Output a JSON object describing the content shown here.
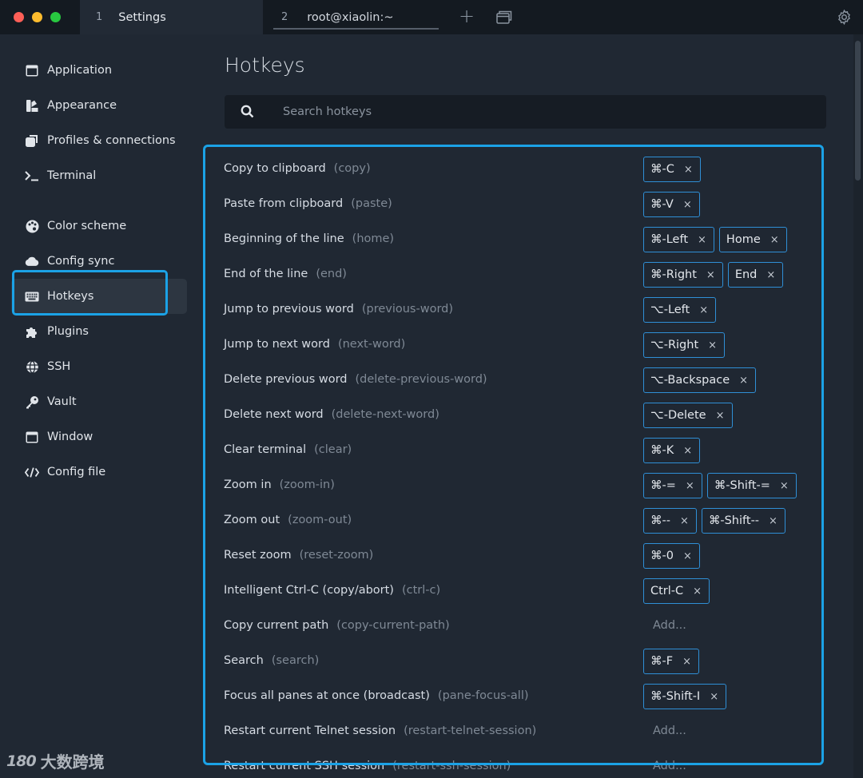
{
  "tabs": [
    {
      "num": "1",
      "label": "Settings"
    },
    {
      "num": "2",
      "label": "root@xiaolin:~"
    }
  ],
  "sidebar": {
    "items": [
      {
        "label": "Application",
        "icon": "window-icon"
      },
      {
        "label": "Appearance",
        "icon": "paint-icon"
      },
      {
        "label": "Profiles & connections",
        "icon": "profiles-icon"
      },
      {
        "label": "Terminal",
        "icon": "terminal-icon"
      },
      {
        "label": "Color scheme",
        "icon": "palette-icon"
      },
      {
        "label": "Config sync",
        "icon": "cloud-icon"
      },
      {
        "label": "Hotkeys",
        "icon": "keyboard-icon"
      },
      {
        "label": "Plugins",
        "icon": "puzzle-icon"
      },
      {
        "label": "SSH",
        "icon": "globe-icon"
      },
      {
        "label": "Vault",
        "icon": "key-icon"
      },
      {
        "label": "Window",
        "icon": "window-icon"
      },
      {
        "label": "Config file",
        "icon": "code-icon"
      }
    ],
    "active": "Hotkeys"
  },
  "main": {
    "title": "Hotkeys",
    "search": {
      "placeholder": "Search hotkeys",
      "value": ""
    },
    "add_label": "Add...",
    "hotkeys": [
      {
        "label": "Copy to clipboard",
        "id": "(copy)",
        "keys": [
          "⌘-C"
        ]
      },
      {
        "label": "Paste from clipboard",
        "id": "(paste)",
        "keys": [
          "⌘-V"
        ]
      },
      {
        "label": "Beginning of the line",
        "id": "(home)",
        "keys": [
          "⌘-Left",
          "Home"
        ]
      },
      {
        "label": "End of the line",
        "id": "(end)",
        "keys": [
          "⌘-Right",
          "End"
        ]
      },
      {
        "label": "Jump to previous word",
        "id": "(previous-word)",
        "keys": [
          "⌥-Left"
        ]
      },
      {
        "label": "Jump to next word",
        "id": "(next-word)",
        "keys": [
          "⌥-Right"
        ]
      },
      {
        "label": "Delete previous word",
        "id": "(delete-previous-word)",
        "keys": [
          "⌥-Backspace"
        ]
      },
      {
        "label": "Delete next word",
        "id": "(delete-next-word)",
        "keys": [
          "⌥-Delete"
        ]
      },
      {
        "label": "Clear terminal",
        "id": "(clear)",
        "keys": [
          "⌘-K"
        ]
      },
      {
        "label": "Zoom in",
        "id": "(zoom-in)",
        "keys": [
          "⌘-=",
          "⌘-Shift-="
        ]
      },
      {
        "label": "Zoom out",
        "id": "(zoom-out)",
        "keys": [
          "⌘--",
          "⌘-Shift--"
        ]
      },
      {
        "label": "Reset zoom",
        "id": "(reset-zoom)",
        "keys": [
          "⌘-0"
        ]
      },
      {
        "label": "Intelligent Ctrl-C (copy/abort)",
        "id": "(ctrl-c)",
        "keys": [
          "Ctrl-C"
        ]
      },
      {
        "label": "Copy current path",
        "id": "(copy-current-path)",
        "keys": []
      },
      {
        "label": "Search",
        "id": "(search)",
        "keys": [
          "⌘-F"
        ]
      },
      {
        "label": "Focus all panes at once (broadcast)",
        "id": "(pane-focus-all)",
        "keys": [
          "⌘-Shift-I"
        ]
      },
      {
        "label": "Restart current Telnet session",
        "id": "(restart-telnet-session)",
        "keys": []
      },
      {
        "label": "Restart current SSH session",
        "id": "(restart-ssh-session)",
        "keys": []
      }
    ]
  },
  "watermark": {
    "logo": "180",
    "text": "大数跨境"
  },
  "colors": {
    "accent": "#1ba2e6",
    "key_border": "#2f8fd6",
    "background": "#202833",
    "titlebar": "#141a21"
  }
}
